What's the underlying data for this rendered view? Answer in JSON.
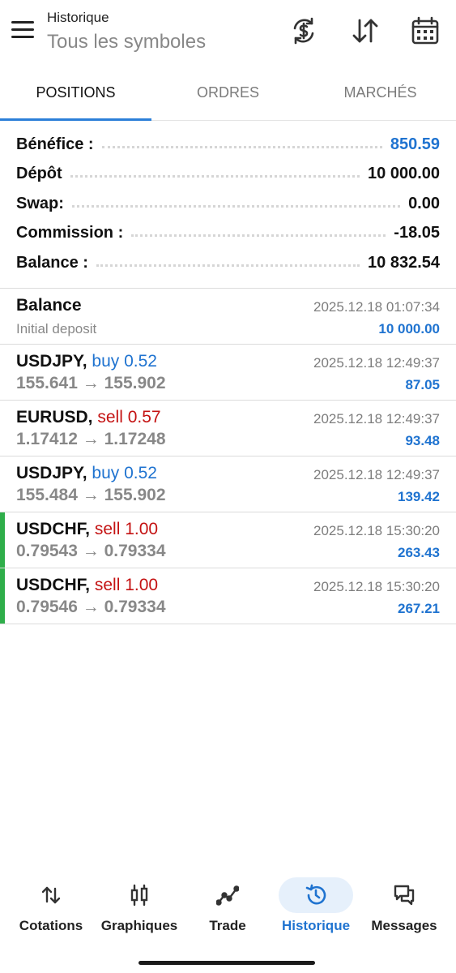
{
  "header": {
    "title": "Historique",
    "subtitle": "Tous les symboles",
    "icons": [
      "menu-icon",
      "currency-exchange-icon",
      "sort-icon",
      "calendar-icon"
    ]
  },
  "tabs": [
    {
      "label": "POSITIONS",
      "active": true
    },
    {
      "label": "ORDRES",
      "active": false
    },
    {
      "label": "MARCHÉS",
      "active": false
    }
  ],
  "summary": [
    {
      "label": "Bénéfice :",
      "value": "850.59",
      "highlight": true
    },
    {
      "label": "Dépôt",
      "value": "10 000.00",
      "highlight": false
    },
    {
      "label": "Swap:",
      "value": "0.00",
      "highlight": false
    },
    {
      "label": "Commission :",
      "value": "-18.05",
      "highlight": false
    },
    {
      "label": "Balance :",
      "value": "10 832.54",
      "highlight": false
    }
  ],
  "deals": [
    {
      "symbol": "Balance",
      "side": "",
      "volume": "",
      "open": "",
      "close": "",
      "comment": "Initial deposit",
      "time": "2025.12.18 01:07:34",
      "profit": "10 000.00",
      "marked": false
    },
    {
      "symbol": "USDJPY,",
      "side": "buy",
      "volume": "0.52",
      "open": "155.641",
      "close": "155.902",
      "comment": "",
      "time": "2025.12.18 12:49:37",
      "profit": "87.05",
      "marked": false
    },
    {
      "symbol": "EURUSD,",
      "side": "sell",
      "volume": "0.57",
      "open": "1.17412",
      "close": "1.17248",
      "comment": "",
      "time": "2025.12.18 12:49:37",
      "profit": "93.48",
      "marked": false
    },
    {
      "symbol": "USDJPY,",
      "side": "buy",
      "volume": "0.52",
      "open": "155.484",
      "close": "155.902",
      "comment": "",
      "time": "2025.12.18 12:49:37",
      "profit": "139.42",
      "marked": false
    },
    {
      "symbol": "USDCHF,",
      "side": "sell",
      "volume": "1.00",
      "open": "0.79543",
      "close": "0.79334",
      "comment": "",
      "time": "2025.12.18 15:30:20",
      "profit": "263.43",
      "marked": true
    },
    {
      "symbol": "USDCHF,",
      "side": "sell",
      "volume": "1.00",
      "open": "0.79546",
      "close": "0.79334",
      "comment": "",
      "time": "2025.12.18 15:30:20",
      "profit": "267.21",
      "marked": true
    }
  ],
  "arrow": "→",
  "bottom_nav": [
    {
      "label": "Cotations",
      "icon": "quotes-arrows-icon",
      "active": false
    },
    {
      "label": "Graphiques",
      "icon": "candlestick-icon",
      "active": false
    },
    {
      "label": "Trade",
      "icon": "trade-line-icon",
      "active": false
    },
    {
      "label": "Historique",
      "icon": "history-icon",
      "active": true
    },
    {
      "label": "Messages",
      "icon": "messages-icon",
      "active": false
    }
  ],
  "colors": {
    "accent": "#1f73d0",
    "buy": "#1f73d0",
    "sell": "#c41212",
    "position_marker": "#2fae4a",
    "tab_indicator": "#2b7fd8"
  }
}
